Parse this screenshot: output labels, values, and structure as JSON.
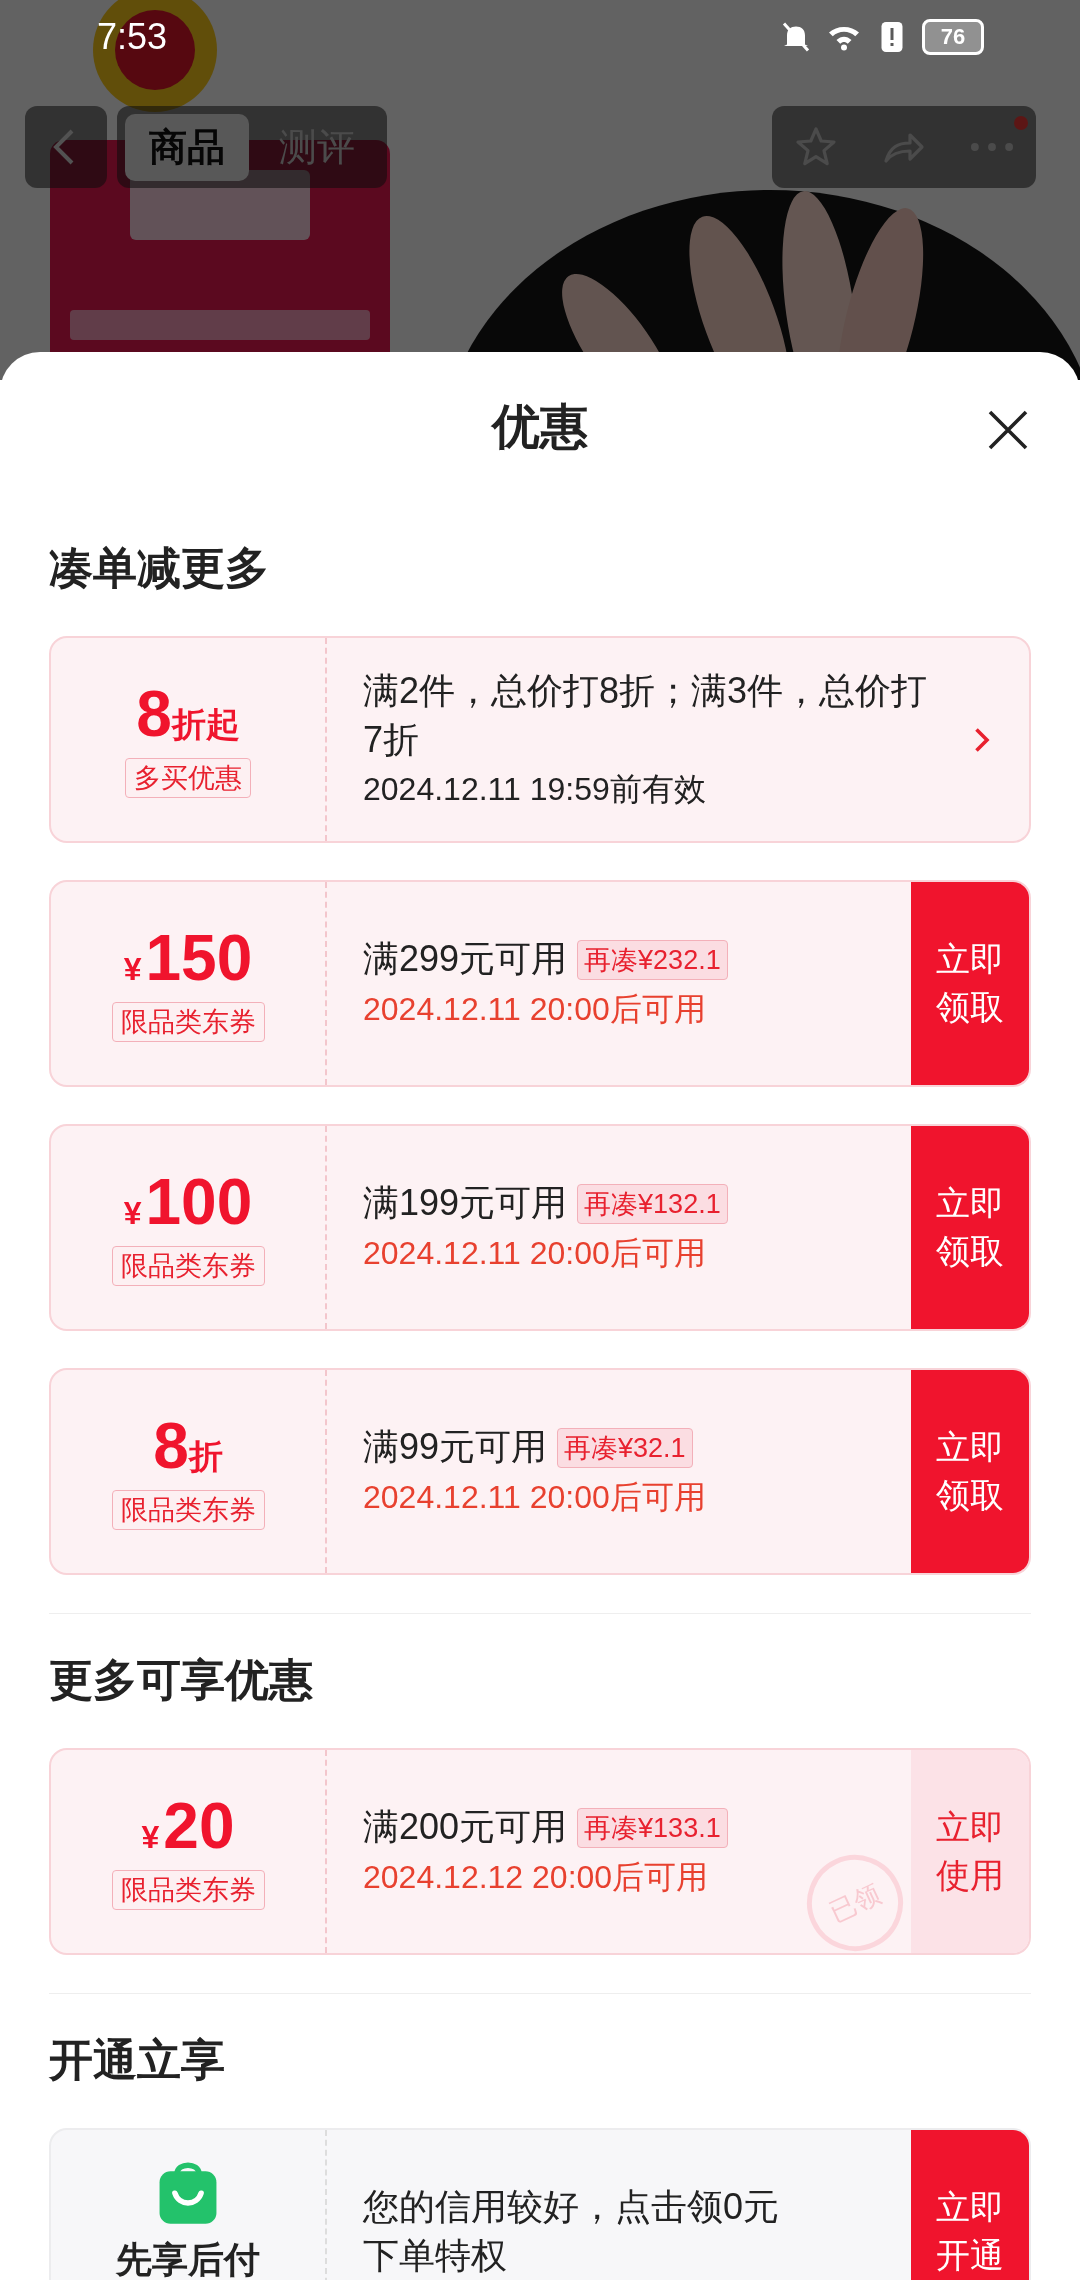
{
  "status_bar": {
    "time": "7:53",
    "battery": "76"
  },
  "nav": {
    "tabs": [
      {
        "label": "商品",
        "selected": true
      },
      {
        "label": "测评",
        "selected": false
      }
    ],
    "notification": true
  },
  "sheet": {
    "title": "优惠"
  },
  "sections": [
    {
      "title": "凑单减更多",
      "cards": [
        {
          "kind": "discount",
          "amount": "8",
          "unit": "折起",
          "tag": "多买优惠",
          "condition": "满2件，总价打8折；满3件，总价打7折",
          "validity": "2024.12.11 19:59前有效"
        },
        {
          "kind": "coupon",
          "prefix": "¥",
          "amount": "150",
          "tag": "限品类东券",
          "condition": "满299元可用",
          "topup": "再凑¥232.1",
          "validity": "2024.12.11 20:00后可用",
          "action": {
            "label": "立即领取",
            "kind": "claim"
          }
        },
        {
          "kind": "coupon",
          "prefix": "¥",
          "amount": "100",
          "tag": "限品类东券",
          "condition": "满199元可用",
          "topup": "再凑¥132.1",
          "validity": "2024.12.11 20:00后可用",
          "action": {
            "label": "立即领取",
            "kind": "claim"
          }
        },
        {
          "kind": "coupon",
          "amount": "8",
          "unit": "折",
          "tag": "限品类东券",
          "condition": "满99元可用",
          "topup": "再凑¥32.1",
          "validity": "2024.12.11 20:00后可用",
          "action": {
            "label": "立即领取",
            "kind": "claim"
          }
        }
      ]
    },
    {
      "title": "更多可享优惠",
      "cards": [
        {
          "kind": "coupon",
          "prefix": "¥",
          "amount": "20",
          "tag": "限品类东券",
          "condition": "满200元可用",
          "topup": "再凑¥133.1",
          "validity": "2024.12.12 20:00后可用",
          "stamp": "已领",
          "action": {
            "label": "立即使用",
            "kind": "use"
          }
        }
      ]
    },
    {
      "title": "开通立享",
      "cards": [
        {
          "kind": "service",
          "label": "先享后付",
          "condition": "您的信用较好，点击领0元下单特权",
          "action": {
            "label": "立即开通",
            "kind": "claim"
          }
        }
      ]
    }
  ]
}
